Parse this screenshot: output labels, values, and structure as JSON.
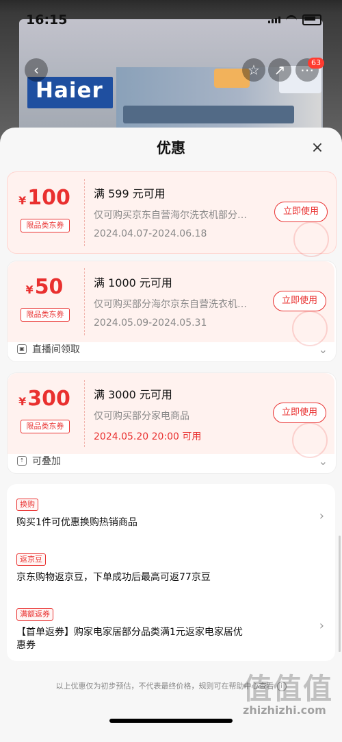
{
  "status": {
    "time": "16:15"
  },
  "hero": {
    "brand": "Haier",
    "badge_count": "63"
  },
  "sheet": {
    "title": "优惠"
  },
  "coupons": [
    {
      "currency": "¥",
      "amount": "100",
      "tag": "限品类东券",
      "condition": "满 599 元可用",
      "scope": "仅可购买京东自营海尔洗衣机部分…",
      "date": "2024.04.07-2024.06.18",
      "action": "立即使用"
    },
    {
      "currency": "¥",
      "amount": "50",
      "tag": "限品类东券",
      "condition": "满 1000 元可用",
      "scope": "仅可购买部分海尔京东自营洗衣机…",
      "date": "2024.05.09-2024.05.31",
      "action": "立即使用",
      "footer": "直播间领取"
    },
    {
      "currency": "¥",
      "amount": "300",
      "tag": "限品类东券",
      "condition": "满 3000 元可用",
      "scope": "仅可购买部分家电商品",
      "date": "2024.05.20 20:00 可用",
      "action": "立即使用",
      "footer": "可叠加"
    }
  ],
  "benefits": [
    {
      "tag": "换购",
      "text": "购买1件可优惠换购热销商品"
    },
    {
      "tag": "返京豆",
      "text": "京东购物返京豆，下单成功后最高可返77京豆"
    },
    {
      "tag": "满额返券",
      "text": "【首单返券】购家电家居部分品类满1元返家电家居优惠券"
    }
  ],
  "disclaimer": "以上优惠仅为初步预估，不代表最终价格，规则可在帮助中心查看",
  "watermark": {
    "logo": "值值值",
    "site": "zhizhizhi.com"
  },
  "colors": {
    "accent": "#e9302f",
    "coupon_bg": "#fff2ef"
  }
}
